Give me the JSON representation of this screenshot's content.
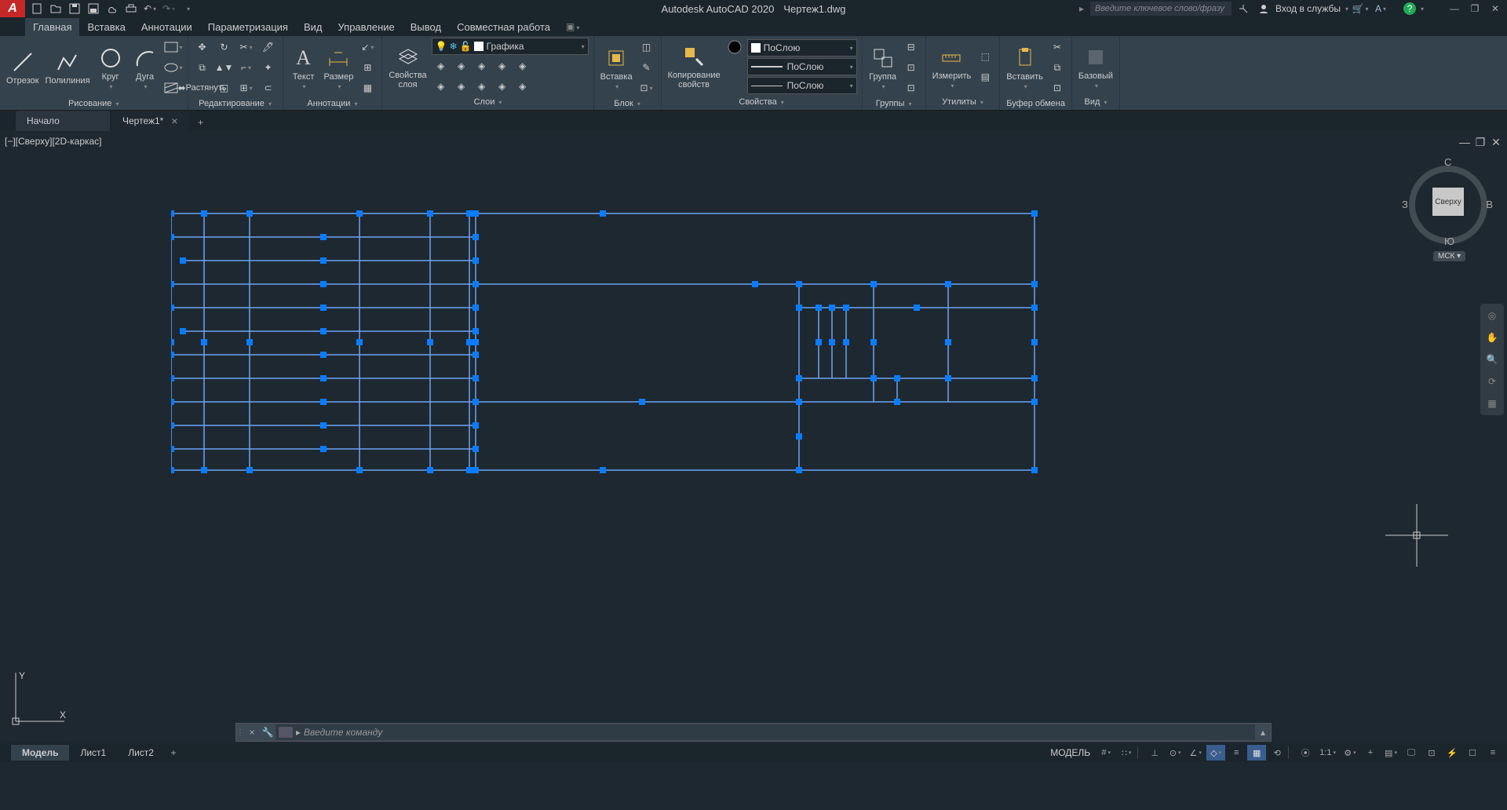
{
  "title": {
    "app": "Autodesk AutoCAD 2020",
    "file": "Чертеж1.dwg"
  },
  "search_placeholder": "Введите ключевое слово/фразу",
  "signin_label": "Вход в службы",
  "menu": {
    "tabs": [
      "Главная",
      "Вставка",
      "Аннотации",
      "Параметризация",
      "Вид",
      "Управление",
      "Вывод",
      "Совместная работа"
    ],
    "active": "Главная"
  },
  "ribbon": {
    "draw": {
      "title": "Рисование",
      "line": "Отрезок",
      "polyline": "Полилиния",
      "circle": "Круг",
      "arc": "Дуга"
    },
    "modify": {
      "title": "Редактирование",
      "stretch": "Растянуть"
    },
    "annotation": {
      "title": "Аннотации",
      "text": "Текст",
      "dim": "Размер"
    },
    "layers": {
      "title": "Слои",
      "props": "Свойства\nслоя",
      "current": "Графика"
    },
    "block": {
      "title": "Блок",
      "insert": "Вставка"
    },
    "properties": {
      "title": "Свойства",
      "match": "Копирование\nсвойств",
      "bylayer": "ПоСлою"
    },
    "groups": {
      "title": "Группы",
      "group": "Группа"
    },
    "utilities": {
      "title": "Утилиты",
      "measure": "Измерить"
    },
    "clipboard": {
      "title": "Буфер обмена",
      "paste": "Вставить"
    },
    "view": {
      "title": "Вид",
      "base": "Базовый"
    }
  },
  "file_tabs": {
    "start": "Начало",
    "drawing": "Чертеж1*"
  },
  "viewport_label": "[−][Сверху][2D-каркас]",
  "viewcube": {
    "face": "Сверху",
    "n": "С",
    "e": "В",
    "s": "Ю",
    "w": "З",
    "wcs": "МСК"
  },
  "command": {
    "placeholder": "Введите  команду"
  },
  "layout_tabs": {
    "model": "Модель",
    "layout1": "Лист1",
    "layout2": "Лист2"
  },
  "status": {
    "model": "МОДЕЛЬ",
    "scale": "1:1"
  }
}
